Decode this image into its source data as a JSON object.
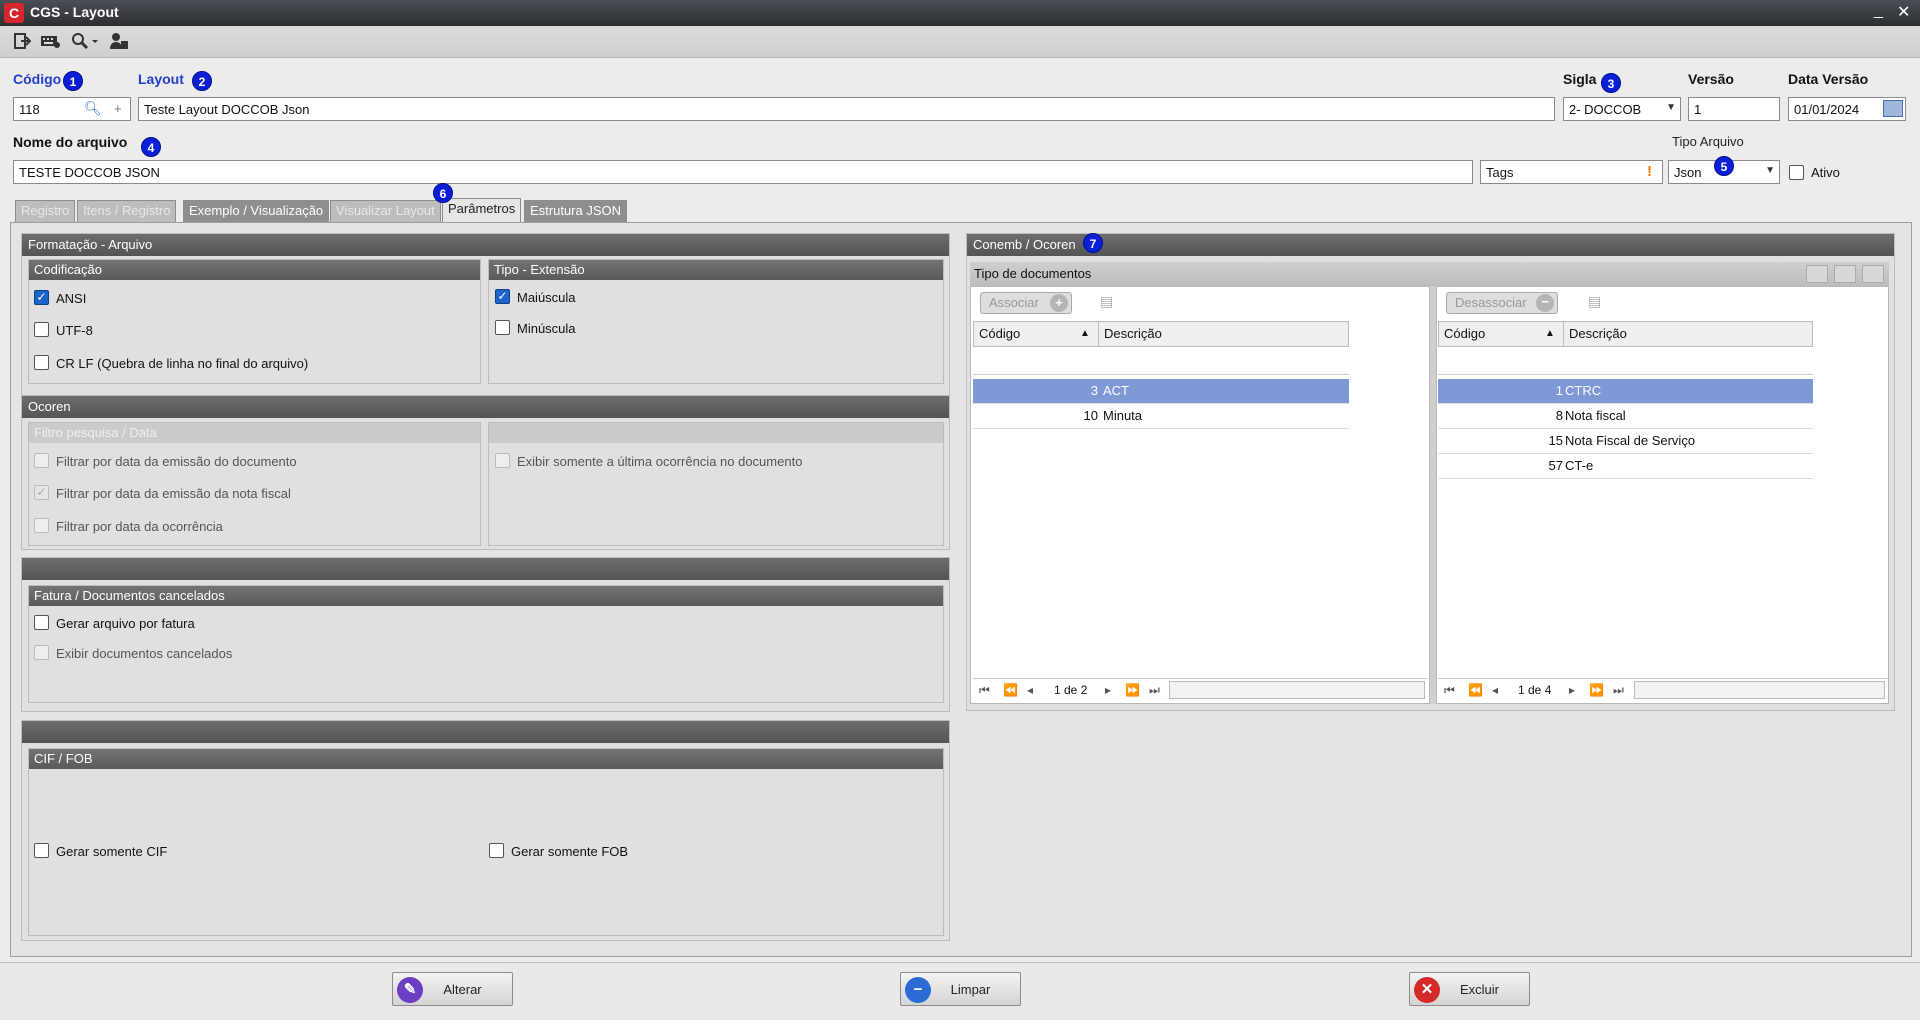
{
  "window": {
    "title": "CGS - Layout",
    "logo_text": "C",
    "min": "_",
    "close": "✕"
  },
  "toolbar": {
    "icons": [
      "exit-icon",
      "keyboard-icon",
      "search-icon",
      "user-card-icon"
    ]
  },
  "fields": {
    "codigo_label": "Código",
    "codigo_value": "118",
    "layout_label": "Layout",
    "layout_value": "Teste Layout DOCCOB Json",
    "sigla_label": "Sigla",
    "sigla_value": "2- DOCCOB",
    "versao_label": "Versão",
    "versao_value": "1",
    "data_versao_label": "Data Versão",
    "data_versao_value": "01/01/2024",
    "nome_arquivo_label": "Nome do arquivo",
    "nome_arquivo_value": "TESTE DOCCOB JSON",
    "tags_value": "Tags",
    "tipo_arquivo_label": "Tipo Arquivo",
    "tipo_arquivo_value": "Json",
    "ativo_label": "Ativo"
  },
  "badges": [
    "1",
    "2",
    "3",
    "4",
    "5",
    "6",
    "7"
  ],
  "tabs": [
    {
      "label": "Registro",
      "state": "disabled"
    },
    {
      "label": "Itens / Registro",
      "state": "disabled"
    },
    {
      "label": "Exemplo / Visualização",
      "state": "normal"
    },
    {
      "label": "Visualizar Layout",
      "state": "disabled"
    },
    {
      "label": "Parâmetros",
      "state": "active"
    },
    {
      "label": "Estrutura JSON",
      "state": "normal"
    }
  ],
  "formatacao": {
    "title": "Formatação - Arquivo",
    "codificacao": {
      "title": "Codificação",
      "options": [
        {
          "label": "ANSI",
          "checked": true
        },
        {
          "label": "UTF-8",
          "checked": false
        },
        {
          "label": "CR LF (Quebra de linha no final do arquivo)",
          "checked": false
        }
      ]
    },
    "tipo_extensao": {
      "title": "Tipo - Extensão",
      "options": [
        {
          "label": "Maiúscula",
          "checked": true
        },
        {
          "label": "Minúscula",
          "checked": false
        }
      ]
    }
  },
  "ocoren": {
    "title": "Ocoren",
    "filtro_title": "Filtro pesquisa / Data",
    "filtros": [
      {
        "label": "Filtrar por data da emissão do documento",
        "checked": false
      },
      {
        "label": "Filtrar por data da emissão da nota fiscal",
        "checked": true
      },
      {
        "label": "Filtrar por data da ocorrência",
        "checked": false
      }
    ],
    "exibir_ultima": "Exibir somente a última ocorrência no documento"
  },
  "fatura": {
    "title": "Fatura / Documentos cancelados",
    "gerar_por_fatura": "Gerar arquivo por fatura",
    "exibir_cancelados": "Exibir documentos cancelados"
  },
  "ciffob": {
    "title": "CIF / FOB",
    "cif": "Gerar somente CIF",
    "fob": "Gerar somente FOB"
  },
  "conemb": {
    "title": "Conemb / Ocoren",
    "tipo_docs_title": "Tipo de documentos",
    "associar": "Associar",
    "desassociar": "Desassociar",
    "col_codigo": "Código",
    "col_descricao": "Descrição",
    "sort_icon": "▲",
    "left_rows": [
      {
        "codigo": "3",
        "descricao": "ACT"
      },
      {
        "codigo": "10",
        "descricao": "Minuta"
      }
    ],
    "right_rows": [
      {
        "codigo": "1",
        "descricao": "CTRC"
      },
      {
        "codigo": "8",
        "descricao": "Nota fiscal"
      },
      {
        "codigo": "15",
        "descricao": "Nota Fiscal de Serviço"
      },
      {
        "codigo": "57",
        "descricao": "CT-e"
      }
    ],
    "left_pager": "1 de 2",
    "right_pager": "1 de 4"
  },
  "footer": {
    "alterar": "Alterar",
    "limpar": "Limpar",
    "excluir": "Excluir"
  }
}
